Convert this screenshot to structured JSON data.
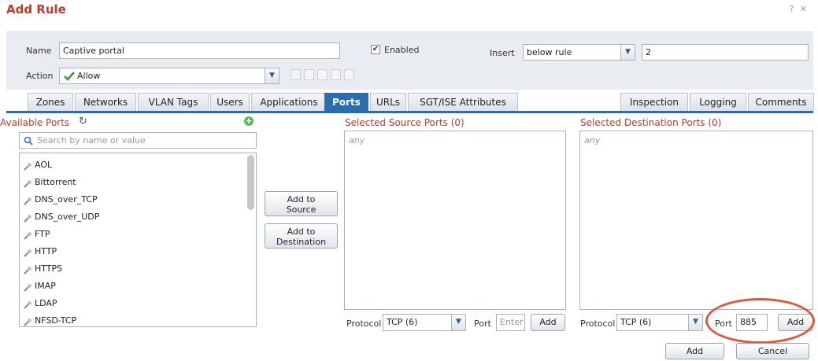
{
  "dialog": {
    "title": "Add Rule",
    "window_controls": "? ✕"
  },
  "form": {
    "name_label": "Name",
    "name_value": "Captive portal",
    "enabled_label": "Enabled",
    "enabled_checked": true,
    "insert_label": "Insert",
    "insert_value": "below rule",
    "insert_number": "2",
    "action_label": "Action",
    "action_value": "Allow"
  },
  "tabs": {
    "left": [
      "Zones",
      "Networks",
      "VLAN Tags",
      "Users",
      "Applications",
      "Ports",
      "URLs",
      "SGT/ISE Attributes"
    ],
    "right": [
      "Inspection",
      "Logging",
      "Comments"
    ],
    "active": "Ports"
  },
  "available_ports": {
    "title": "Available Ports",
    "search_placeholder": "Search by name or value",
    "items": [
      "AOL",
      "Bittorrent",
      "DNS_over_TCP",
      "DNS_over_UDP",
      "FTP",
      "HTTP",
      "HTTPS",
      "IMAP",
      "LDAP",
      "NFSD-TCP"
    ]
  },
  "middle_buttons": {
    "add_to_source_line1": "Add to",
    "add_to_source_line2": "Source",
    "add_to_dest_line1": "Add to",
    "add_to_dest_line2": "Destination"
  },
  "source_ports": {
    "title": "Selected Source Ports (0)",
    "placeholder": "any",
    "protocol_label": "Protocol",
    "protocol_value": "TCP (6)",
    "port_label": "Port",
    "port_placeholder": "Enter",
    "add_label": "Add"
  },
  "dest_ports": {
    "title": "Selected Destination Ports (0)",
    "placeholder": "any",
    "protocol_label": "Protocol",
    "protocol_value": "TCP (6)",
    "port_label": "Port",
    "port_value": "885",
    "add_label": "Add"
  },
  "footer": {
    "add_label": "Add",
    "cancel_label": "Cancel"
  },
  "colors": {
    "accent": "#2c6db0",
    "title_red": "#c0392b",
    "highlight_oval": "#e2553d",
    "allow_green": "#3a9a2f"
  }
}
